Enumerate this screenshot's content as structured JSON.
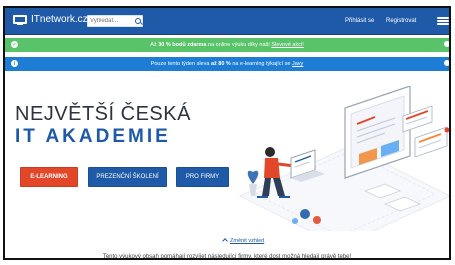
{
  "topbar": {
    "brand": "ITnetwork.cz",
    "search_placeholder": "Vyhledat...",
    "login": "Přihlásit se",
    "register": "Registrovat"
  },
  "promos": {
    "green": {
      "prefix": "Až",
      "bold": "30 % bodů zdarma",
      "middle": "na online výuku díky naší",
      "link": "Slevové akci!"
    },
    "blue": {
      "prefix": "Pouze tento týden sleva",
      "bold": "až 80 %",
      "middle": "na e-learning týkající se",
      "link": "Javy"
    }
  },
  "hero": {
    "line1": "NEJVĚTŠÍ ČESKÁ",
    "line2": "IT AKADEMIE"
  },
  "buttons": {
    "elearning": "E-LEARNING",
    "prezencni": "PREZENČNÍ ŠKOLENÍ",
    "firmy": "PRO FIRMY"
  },
  "change_look": "Změnit vzhled",
  "footer": "Tento výukový obsah pomáhají rozvíjet následující firmy, které dost možná hledají právě tebe!",
  "colors": {
    "topbar": "#1e5aa8",
    "promo_green": "#59c36a",
    "promo_blue": "#1d7cd4",
    "elearning": "#e2472a",
    "primary_blue": "#1e5aa8"
  },
  "icons": {
    "logo": "monitor-logo-icon",
    "search": "search-icon",
    "menu": "hamburger-menu-icon",
    "promo_green": "check-circle-icon",
    "promo_blue": "info-circle-icon",
    "change_look": "chevron-up-icon"
  }
}
